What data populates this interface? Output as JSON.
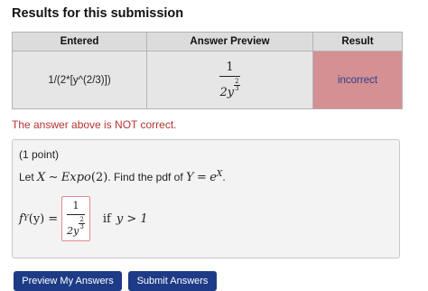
{
  "heading": "Results for this submission",
  "table": {
    "headers": [
      "Entered",
      "Answer Preview",
      "Result"
    ],
    "row": {
      "entered": "1/(2*[y^(2/3)])",
      "preview": {
        "numerator": "1",
        "base": "2y",
        "exp_num": "2",
        "exp_den": "3"
      },
      "result": "incorrect"
    }
  },
  "status_message": "The answer above is NOT correct.",
  "problem": {
    "points": "(1 point)",
    "question": {
      "prefix": "Let",
      "X": "X",
      "tilde": "∼",
      "dist": "Expo",
      "param": "(2)",
      "mid": ". Find the pdf of",
      "Y": "Y",
      "eq": "=",
      "e": "e",
      "exp": "X",
      "end": "."
    },
    "answer": {
      "lhs_f": "f",
      "lhs_sub": "Y",
      "lhs_arg": "(y)",
      "eq": "=",
      "numerator": "1",
      "base": "2y",
      "exp_num": "2",
      "exp_den": "3",
      "condition_if": "if",
      "condition": "y > 1"
    }
  },
  "buttons": {
    "preview": "Preview My Answers",
    "submit": "Submit Answers"
  },
  "colors": {
    "incorrect_bg": "#d49093",
    "error_text": "#b83232",
    "button_bg": "#1d3b86"
  }
}
